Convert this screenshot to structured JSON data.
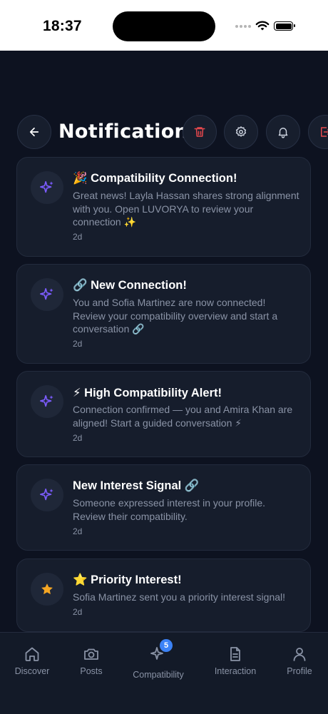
{
  "status_bar": {
    "time": "18:37"
  },
  "header": {
    "title": "Notifications",
    "back_icon": "arrow-left-icon",
    "actions": [
      "trash-icon",
      "gear-icon",
      "bell-icon",
      "logout-icon"
    ],
    "colors": {
      "danger": "#e5484d",
      "icon": "#cfd5e1"
    }
  },
  "notifications": [
    {
      "icon": "sparkles-icon",
      "title": "🎉 Compatibility Connection!",
      "body": "Great news! Layla Hassan shares strong alignment with you. Open LUVORYA to review your connection ✨",
      "time": "2d"
    },
    {
      "icon": "sparkles-icon",
      "title": "🔗 New Connection!",
      "body": "You and Sofia Martinez are now connected! Review your compatibility overview and start a conversation 🔗",
      "time": "2d"
    },
    {
      "icon": "sparkles-icon",
      "title": "⚡ High Compatibility Alert!",
      "body": "Connection confirmed — you and Amira Khan are aligned! Start a guided conversation ⚡",
      "time": "2d"
    },
    {
      "icon": "sparkles-icon",
      "title": "New Interest Signal 🔗",
      "body": "Someone expressed interest in your profile. Review their compatibility.",
      "time": "2d"
    },
    {
      "icon": "star-icon",
      "title": "⭐ Priority Interest!",
      "body": "Sofia Martinez sent you a priority interest signal!",
      "time": "2d"
    }
  ],
  "tabbar": {
    "items": [
      {
        "label": "Discover",
        "icon": "home-icon"
      },
      {
        "label": "Posts",
        "icon": "camera-icon"
      },
      {
        "label": "Compatibility",
        "icon": "sparkles-icon",
        "badge": "5"
      },
      {
        "label": "Interaction",
        "icon": "document-icon"
      },
      {
        "label": "Profile",
        "icon": "user-icon"
      }
    ]
  },
  "colors": {
    "background": "#0d1220",
    "card": "#161d2c",
    "accent_purple": "#7c5cff",
    "star": "#f5a623",
    "badge": "#3b82f6"
  }
}
